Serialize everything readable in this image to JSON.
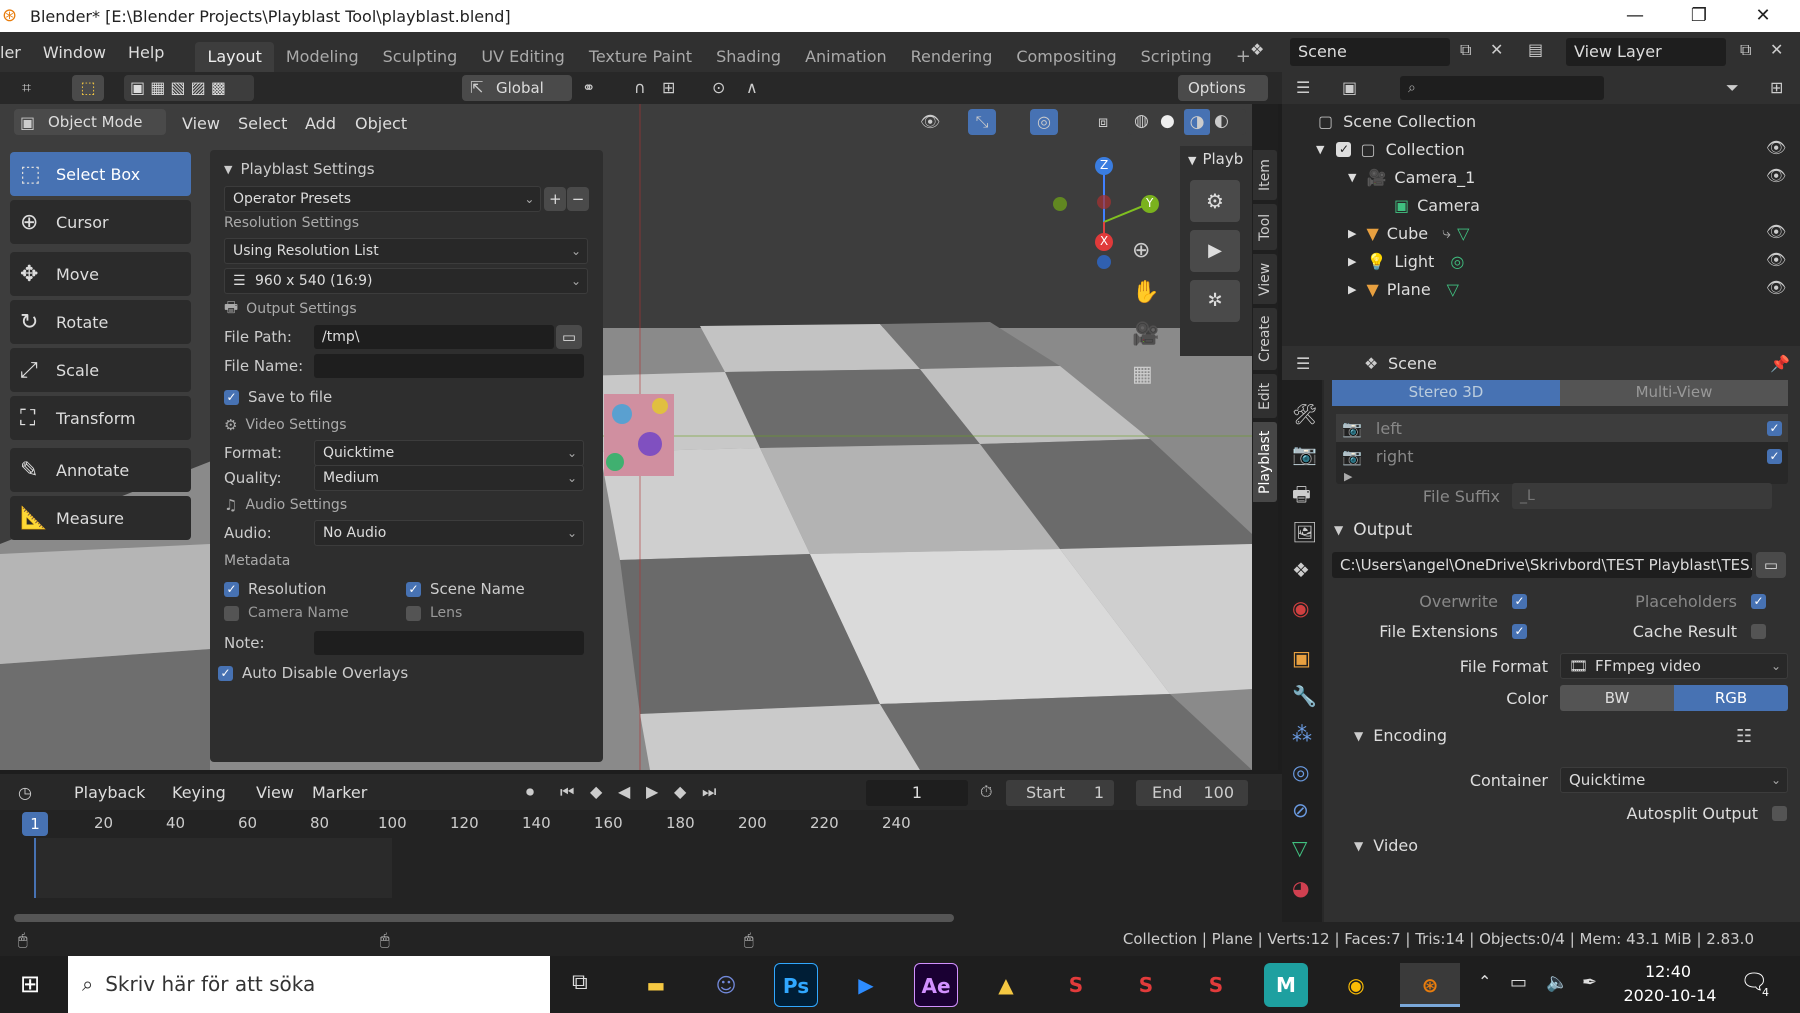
{
  "window": {
    "title": "Blender* [E:\\Blender Projects\\Playblast Tool\\playblast.blend]"
  },
  "menubar": {
    "items": [
      "ler",
      "Window",
      "Help"
    ]
  },
  "workspaces": [
    "Layout",
    "Modeling",
    "Sculpting",
    "UV Editing",
    "Texture Paint",
    "Shading",
    "Animation",
    "Rendering",
    "Compositing",
    "Scripting"
  ],
  "scene": {
    "name": "Scene",
    "view_layer": "View Layer"
  },
  "viewport_header": {
    "orientation": "Global",
    "options": "Options",
    "mode": "Object Mode",
    "menus": [
      "View",
      "Select",
      "Add",
      "Object"
    ]
  },
  "toolbar": {
    "tools": [
      "Select Box",
      "Cursor",
      "Move",
      "Rotate",
      "Scale",
      "Transform",
      "Annotate",
      "Measure"
    ]
  },
  "playblast": {
    "title": "Playblast Settings",
    "presets": "Operator Presets",
    "resolution_header": "Resolution Settings",
    "resolution_mode": "Using Resolution List",
    "resolution": "960 x 540 (16:9)",
    "output_header": "Output Settings",
    "file_path_label": "File Path:",
    "file_path": "/tmp\\",
    "file_name_label": "File Name:",
    "file_name": "",
    "save_to_file": "Save to file",
    "video_header": "Video Settings",
    "format_label": "Format:",
    "format": "Quicktime",
    "quality_label": "Quality:",
    "quality": "Medium",
    "audio_header": "Audio Settings",
    "audio_label": "Audio:",
    "audio": "No Audio",
    "metadata_header": "Metadata",
    "meta_resolution": "Resolution",
    "meta_scene_name": "Scene Name",
    "meta_camera_name": "Camera Name",
    "meta_lens": "Lens",
    "note_label": "Note:",
    "auto_disable": "Auto Disable Overlays"
  },
  "npanel": {
    "header": "Playb",
    "tabs": [
      "Item",
      "Tool",
      "View",
      "Create",
      "Edit",
      "Playblast"
    ]
  },
  "gizmo": {
    "z": "Z",
    "y": "Y",
    "x": "X"
  },
  "outliner": {
    "root": "Scene Collection",
    "items": [
      "Collection",
      "Camera_1",
      "Camera",
      "Cube",
      "Light",
      "Plane"
    ]
  },
  "properties": {
    "context": "Scene",
    "stereo_tabs": [
      "Stereo 3D",
      "Multi-View"
    ],
    "views": [
      "left",
      "right"
    ],
    "file_suffix_label": "File Suffix",
    "file_suffix": "_L",
    "output_header": "Output",
    "output_path": "C:\\Users\\angel\\OneDrive\\Skrivbord\\TEST Playblast\\TES...",
    "overwrite": "Overwrite",
    "placeholders": "Placeholders",
    "file_extensions": "File Extensions",
    "cache_result": "Cache Result",
    "file_format_label": "File Format",
    "file_format": "FFmpeg video",
    "color_label": "Color",
    "color_options": [
      "BW",
      "RGB"
    ],
    "encoding_header": "Encoding",
    "container_label": "Container",
    "container": "Quicktime",
    "autosplit": "Autosplit Output",
    "video_header": "Video"
  },
  "timeline": {
    "menus": [
      "Playback",
      "Keying",
      "View",
      "Marker"
    ],
    "current_frame": "1",
    "start_label": "Start",
    "start": "1",
    "end_label": "End",
    "end": "100",
    "ruler": [
      "1",
      "20",
      "40",
      "60",
      "80",
      "100",
      "120",
      "140",
      "160",
      "180",
      "200",
      "220",
      "240"
    ]
  },
  "statusbar": {
    "text": "Collection | Plane | Verts:12 | Faces:7 | Tris:14 | Objects:0/4 | Mem: 43.1 MiB | 2.83.0"
  },
  "taskbar": {
    "search_placeholder": "Skriv här för att söka",
    "time": "12:40",
    "date": "2020-10-14",
    "notifications": "4",
    "apps": [
      "Ps",
      "Ae",
      "M"
    ]
  },
  "colors": {
    "accent": "#4772b3",
    "orange": "#e87d0d"
  }
}
